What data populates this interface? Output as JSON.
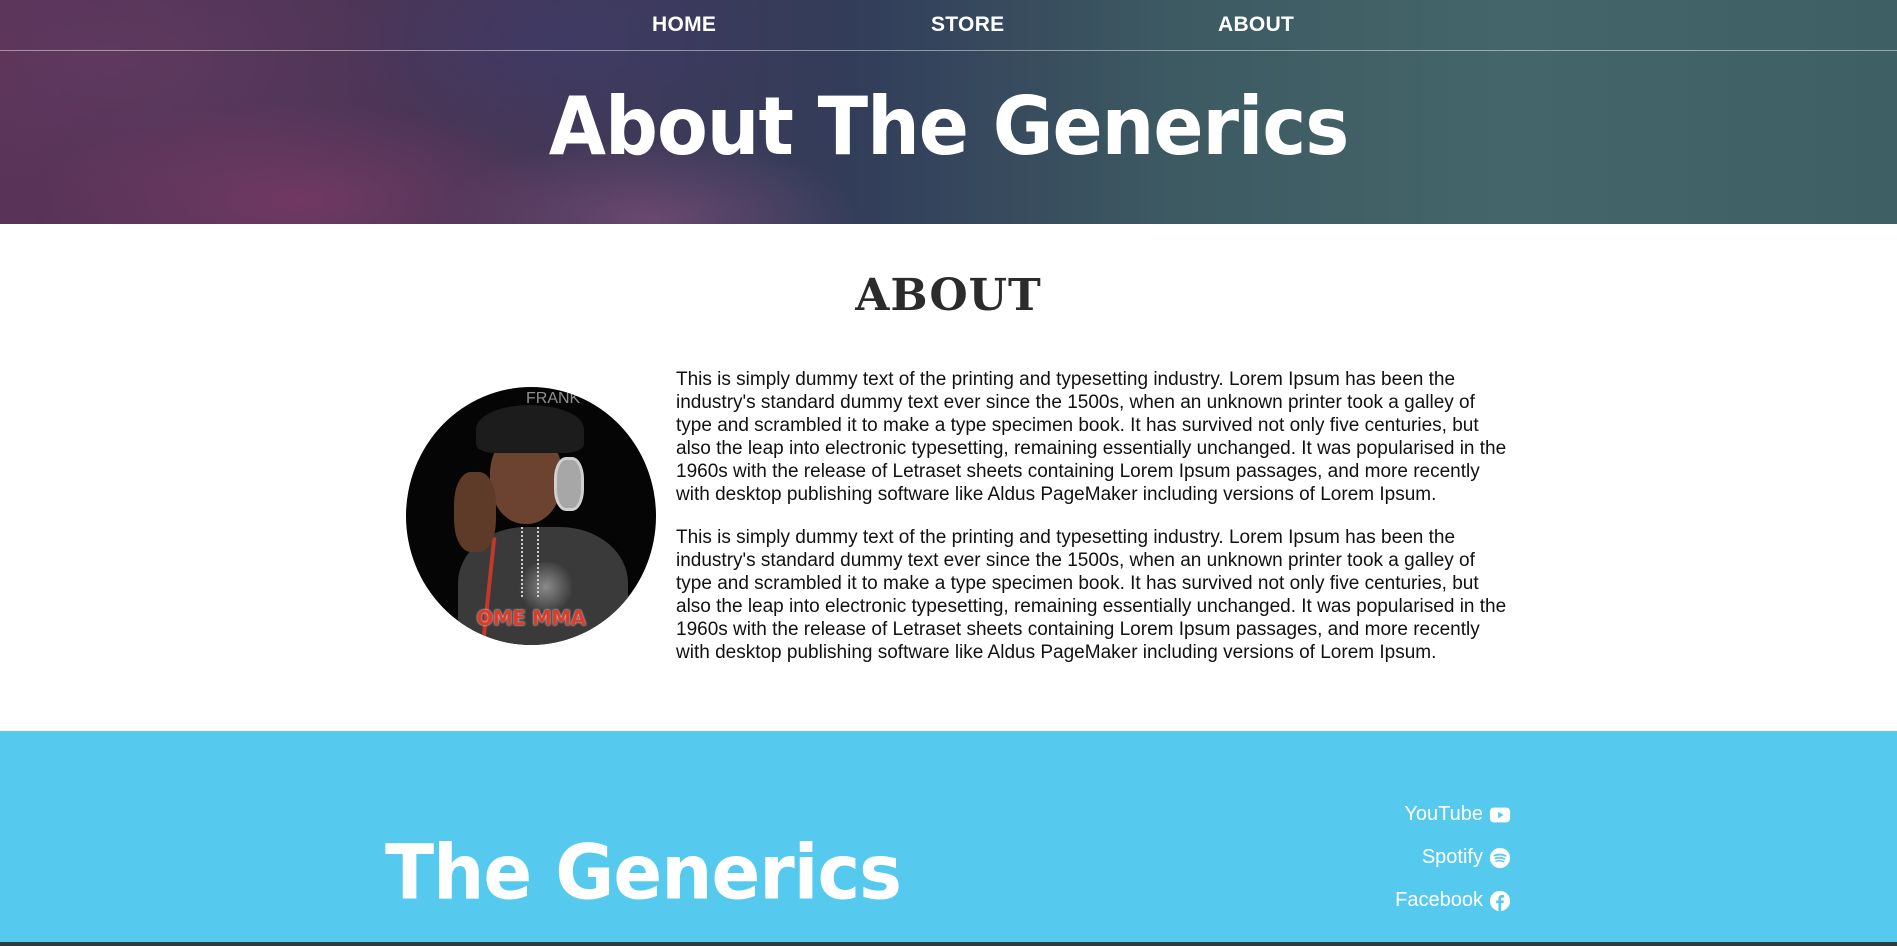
{
  "nav": {
    "items": [
      {
        "label": "HOME"
      },
      {
        "label": "STORE"
      },
      {
        "label": "ABOUT"
      }
    ]
  },
  "hero": {
    "title": "About The Generics"
  },
  "about": {
    "heading": "ABOUT",
    "image": {
      "logo_text": "OME MMA",
      "watermark_text": "FRANK"
    },
    "paragraphs": [
      "This is simply dummy text of the printing and typesetting industry. Lorem Ipsum has been the industry's standard dummy text ever since the 1500s, when an unknown printer took a galley of type and scrambled it to make a type specimen book. It has survived not only five centuries, but also the leap into electronic typesetting, remaining essentially unchanged. It was popularised in the 1960s with the release of Letraset sheets containing Lorem Ipsum passages, and more recently with desktop publishing software like Aldus PageMaker including versions of Lorem Ipsum.",
      "This is simply dummy text of the printing and typesetting industry. Lorem Ipsum has been the industry's standard dummy text ever since the 1500s, when an unknown printer took a galley of type and scrambled it to make a type specimen book. It has survived not only five centuries, but also the leap into electronic typesetting, remaining essentially unchanged. It was popularised in the 1960s with the release of Letraset sheets containing Lorem Ipsum passages, and more recently with desktop publishing software like Aldus PageMaker including versions of Lorem Ipsum."
    ]
  },
  "footer": {
    "brand": "The Generics",
    "social": [
      {
        "label": "YouTube",
        "icon": "youtube-icon"
      },
      {
        "label": "Spotify",
        "icon": "spotify-icon"
      },
      {
        "label": "Facebook",
        "icon": "facebook-icon"
      }
    ]
  },
  "colors": {
    "footer_bg": "#56c9ef",
    "text_white": "#ffffff",
    "heading_dark": "#2b2b2b"
  }
}
